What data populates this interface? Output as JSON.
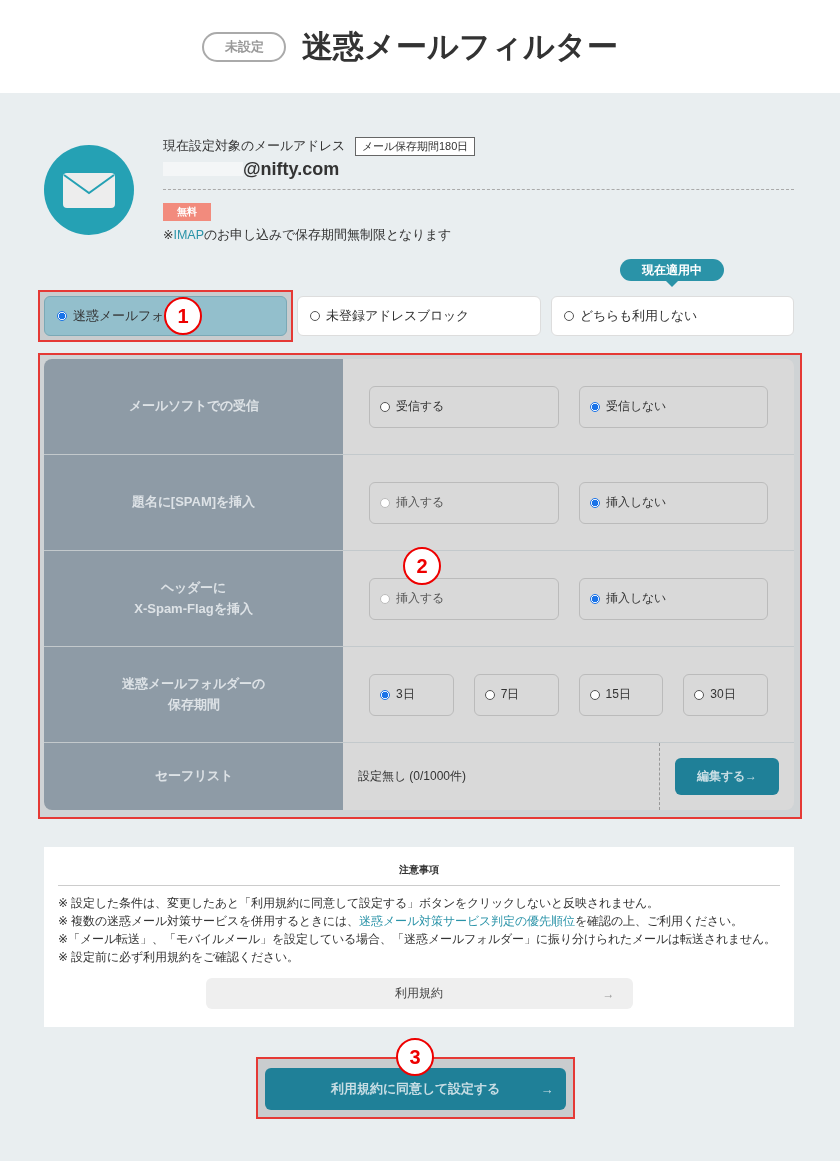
{
  "header": {
    "status_badge": "未設定",
    "title": "迷惑メールフィルター"
  },
  "account": {
    "label": "現在設定対象のメールアドレス",
    "retention_tag": "メール保存期間180日",
    "email": "@nifty.com",
    "plan_badge": "無料",
    "note": {
      "prefix": "※",
      "link": "IMAP",
      "rest": "のお申し込みで保存期間無制限となります"
    }
  },
  "modes": [
    {
      "label": "迷惑メールフォ",
      "selected": true
    },
    {
      "label": "未登録アドレスブロック",
      "selected": false
    },
    {
      "label": "どちらも利用しない",
      "selected": false,
      "badge": "現在適用中"
    }
  ],
  "settings": [
    {
      "kind": "options",
      "label_lines": [
        "メールソフトでの受信"
      ],
      "options": [
        {
          "label": "受信する",
          "selected": false,
          "disabled": false
        },
        {
          "label": "受信しない",
          "selected": true,
          "disabled": false
        }
      ]
    },
    {
      "kind": "options",
      "label_lines": [
        "題名に[SPAM]を挿入"
      ],
      "options": [
        {
          "label": "挿入する",
          "selected": false,
          "disabled": true
        },
        {
          "label": "挿入しない",
          "selected": true,
          "disabled": false
        }
      ]
    },
    {
      "kind": "options",
      "label_lines": [
        "ヘッダーに",
        "X-Spam-Flagを挿入"
      ],
      "options": [
        {
          "label": "挿入する",
          "selected": false,
          "disabled": true
        },
        {
          "label": "挿入しない",
          "selected": true,
          "disabled": false
        }
      ]
    },
    {
      "kind": "options",
      "label_lines": [
        "迷惑メールフォルダーの",
        "保存期間"
      ],
      "options": [
        {
          "label": "3日",
          "selected": true,
          "disabled": false
        },
        {
          "label": "7日",
          "selected": false,
          "disabled": false
        },
        {
          "label": "15日",
          "selected": false,
          "disabled": false
        },
        {
          "label": "30日",
          "selected": false,
          "disabled": false
        }
      ]
    },
    {
      "kind": "safelist",
      "label_lines": [
        "セーフリスト"
      ],
      "value": "設定無し (0/1000件)",
      "button": "編集する→"
    }
  ],
  "notice": {
    "title": "注意事項",
    "lines": [
      [
        {
          "kind": "text",
          "text": "※ 設定した条件は、変更したあと「利用規約に同意して設定する」ボタンをクリックしないと反映されません。"
        }
      ],
      [
        {
          "kind": "text",
          "text": "※ 複数の迷惑メール対策サービスを併用するときには、"
        },
        {
          "kind": "link",
          "text": "迷惑メール対策サービス判定の優先順位"
        },
        {
          "kind": "text",
          "text": "を確認の上、ご利用ください。"
        }
      ],
      [
        {
          "kind": "text",
          "text": "※「メール転送」、「モバイルメール」を設定している場合、「迷惑メールフォルダー」に振り分けられたメールは転送されません。"
        }
      ],
      [
        {
          "kind": "text",
          "text": "※ 設定前に必ず利用規約をご確認ください。"
        }
      ]
    ]
  },
  "terms_button": {
    "label": "利用規約",
    "arrow": "→"
  },
  "submit_button": {
    "label": "利用規約に同意して設定する",
    "arrow": "→"
  },
  "annotations": [
    {
      "number": "1"
    },
    {
      "number": "2"
    },
    {
      "number": "3"
    }
  ]
}
